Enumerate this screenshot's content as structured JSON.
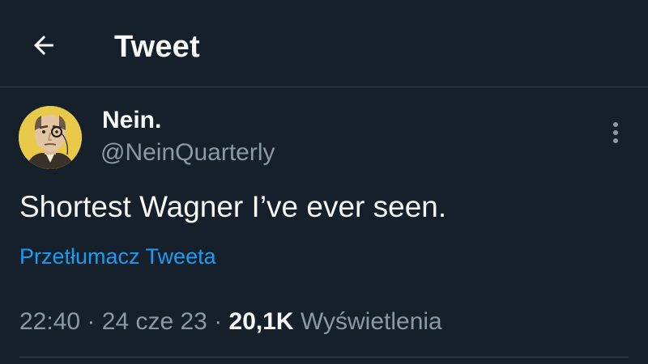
{
  "colors": {
    "background": "#15202b",
    "primary_text": "#f7f9f9",
    "secondary_text": "#8b98a5",
    "link": "#1d9bf0",
    "divider": "#38444d"
  },
  "header": {
    "back_icon": "arrow-left-icon",
    "title": "Tweet"
  },
  "tweet": {
    "author": {
      "display_name": "Nein.",
      "handle": "@NeinQuarterly",
      "avatar_icon": "monocle-portrait-avatar"
    },
    "more_icon": "more-vertical-icon",
    "text": "Shortest Wagner I’ve ever seen.",
    "translate_label": "Przetłumacz Tweeta",
    "time": "22:40",
    "separator": "·",
    "date": "24 cze 23",
    "views_count": "20,1K",
    "views_label": "Wyświetlenia"
  }
}
